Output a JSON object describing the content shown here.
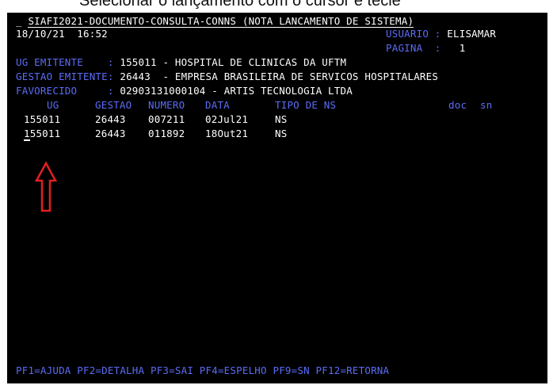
{
  "caption": "Selecionar o lançamento com o cursor e tecle",
  "screen": {
    "title": "SIAFI2021-DOCUMENTO-CONSULTA-CONNS (NOTA LANCAMENTO DE SISTEMA)",
    "date": "18/10/21",
    "time": "16:52",
    "usuario_label": "USUARIO :",
    "usuario_value": "ELISAMAR",
    "pagina_label": "PAGINA  :",
    "pagina_value": "1",
    "ug_emitente_label": "UG EMITENTE    :",
    "ug_emitente_value": "155011 - HOSPITAL DE CLINICAS DA UFTM",
    "gestao_emitente_label": "GESTAO EMITENTE:",
    "gestao_emitente_value": "26443  - EMPRESA BRASILEIRA DE SERVICOS HOSPITALARES",
    "favorecido_label": "FAVORECIDO     :",
    "favorecido_value": "02903131000104 - ARTIS TECNOLOGIA LTDA",
    "columns": [
      "UG",
      "GESTAO",
      "NUMERO",
      "DATA",
      "TIPO DE NS",
      "doc",
      "sn"
    ],
    "rows": [
      {
        "ug": "155011",
        "gestao": "26443",
        "numero": "007211",
        "data": "02Jul21",
        "tipo": "NS"
      },
      {
        "ug": "155011",
        "gestao": "26443",
        "numero": "011892",
        "data": "18Out21",
        "tipo": "NS"
      }
    ],
    "pf_keys": "PF1=AJUDA PF2=DETALHA PF3=SAI PF4=ESPELHO PF9=SN PF12=RETORNA"
  },
  "colors": {
    "background": "#000000",
    "text": "#ffffff",
    "label": "#5b6cf5",
    "arrow": "#e02020"
  },
  "annotation": {
    "arrow_icon": "red-up-arrow-icon"
  }
}
